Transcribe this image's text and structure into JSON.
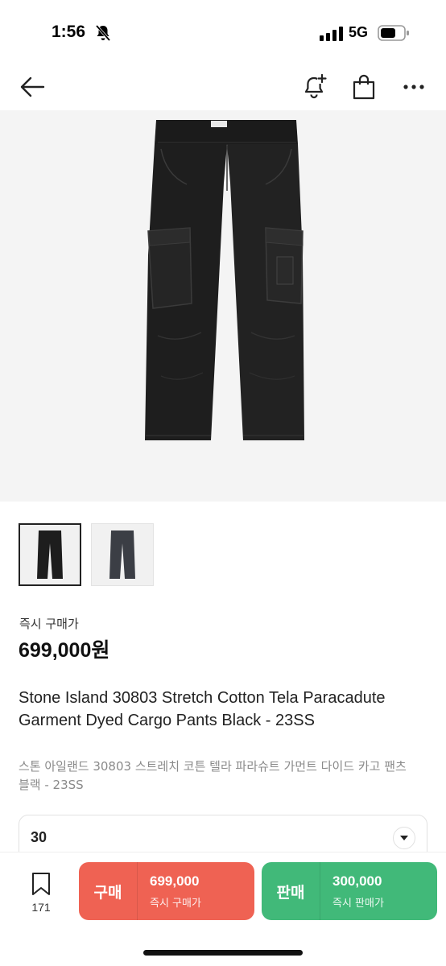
{
  "status_bar": {
    "time": "1:56",
    "network": "5G",
    "icons": [
      "bell-off-icon",
      "signal-icon",
      "battery-icon"
    ]
  },
  "nav": {
    "icons": [
      "back-arrow-icon",
      "bell-plus-icon",
      "shopping-bag-icon",
      "more-icon"
    ]
  },
  "gallery": {
    "thumbnails": [
      "black-pants-thumbnail",
      "grey-pants-thumbnail"
    ]
  },
  "pricing": {
    "label": "즉시 구매가",
    "price": "699,000원"
  },
  "product": {
    "title": "Stone Island 30803 Stretch Cotton Tela Paracadute Garment Dyed Cargo Pants Black - 23SS",
    "subtitle": "스톤 아일랜드 30803 스트레치 코튼 텔라 파라슈트 가먼트 다이드 카고 팬츠 블랙 - 23SS"
  },
  "size_select": {
    "value": "30"
  },
  "bottom_bar": {
    "bookmark_count": "171",
    "buy": {
      "label": "구매",
      "price": "699,000",
      "sub": "즉시 구매가"
    },
    "sell": {
      "label": "판매",
      "price": "300,000",
      "sub": "즉시 판매가"
    }
  },
  "colors": {
    "buy": "#ef6253",
    "sell": "#41b979",
    "image_bg": "#f4f4f4"
  }
}
